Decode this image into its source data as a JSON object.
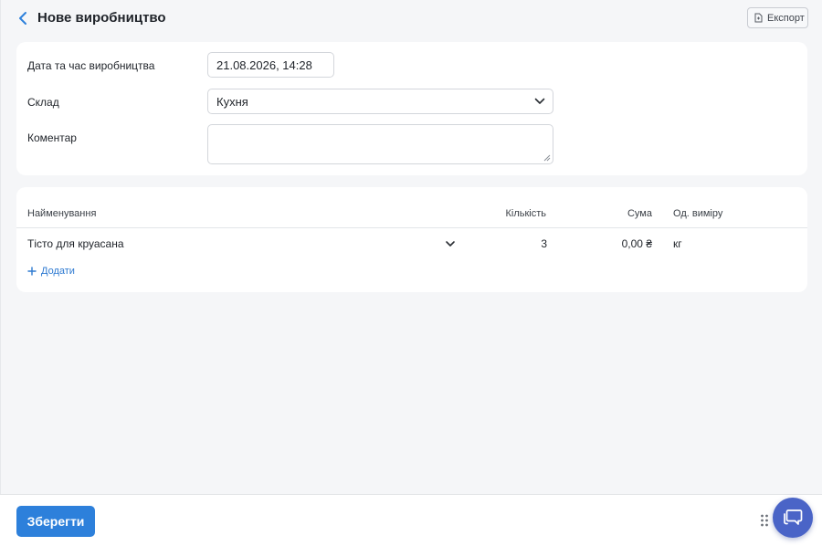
{
  "header": {
    "title": "Нове виробництво",
    "back_icon": "chevron-left-icon",
    "export_label": "Експорт",
    "export_icon": "file-export-icon"
  },
  "form": {
    "date_label": "Дата та час виробництва",
    "date_value": "21.08.2026, 14:28",
    "warehouse_label": "Склад",
    "warehouse_value": "Кухня",
    "comment_label": "Коментар",
    "comment_value": ""
  },
  "table": {
    "columns": {
      "name": "Найменування",
      "quantity": "Кількість",
      "sum": "Сума",
      "unit": "Од. виміру"
    },
    "rows": [
      {
        "name": "Тісто для круасана",
        "quantity": "3",
        "sum": "0,00 ₴",
        "unit": "кг"
      }
    ],
    "add_label": "Додати"
  },
  "footer": {
    "save_label": "Зберегти",
    "chat_icon": "chat-icon",
    "drag_icon": "drag-handle-icon"
  },
  "colors": {
    "accent": "#2d80db",
    "chat": "#4a64c7",
    "background": "#f5f6f8",
    "link": "#2e7ad1"
  }
}
